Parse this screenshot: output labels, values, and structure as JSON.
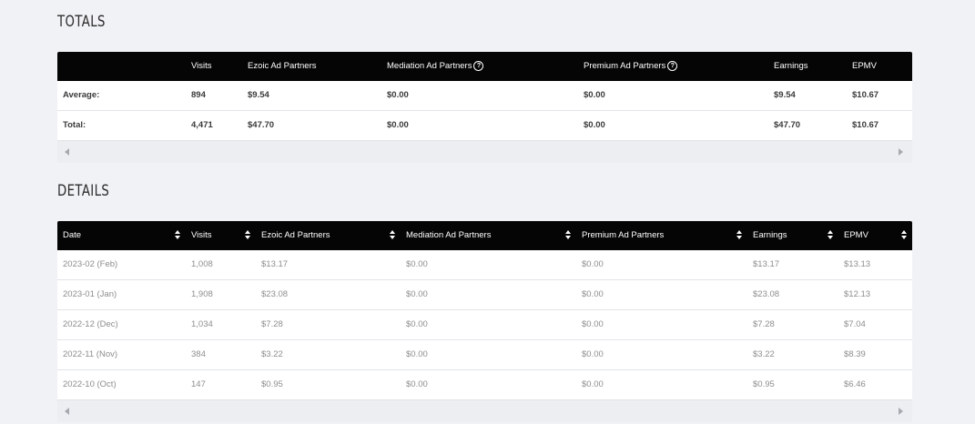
{
  "totals": {
    "title": "TOTALS",
    "columns": [
      "",
      "Visits",
      "Ezoic Ad Partners",
      "Mediation Ad Partners",
      "Premium Ad Partners",
      "Earnings",
      "EPMV"
    ],
    "info_columns": [
      "Mediation Ad Partners",
      "Premium Ad Partners"
    ],
    "rows": [
      [
        "Average:",
        "894",
        "$9.54",
        "$0.00",
        "$0.00",
        "$9.54",
        "$10.67"
      ],
      [
        "Total:",
        "4,471",
        "$47.70",
        "$0.00",
        "$0.00",
        "$47.70",
        "$10.67"
      ]
    ]
  },
  "details": {
    "title": "DETAILS",
    "columns": [
      "Date",
      "Visits",
      "Ezoic Ad Partners",
      "Mediation Ad Partners",
      "Premium Ad Partners",
      "Earnings",
      "EPMV"
    ],
    "rows": [
      [
        "2023-02 (Feb)",
        "1,008",
        "$13.17",
        "$0.00",
        "$0.00",
        "$13.17",
        "$13.13"
      ],
      [
        "2023-01 (Jan)",
        "1,908",
        "$23.08",
        "$0.00",
        "$0.00",
        "$23.08",
        "$12.13"
      ],
      [
        "2022-12 (Dec)",
        "1,034",
        "$7.28",
        "$0.00",
        "$0.00",
        "$7.28",
        "$7.04"
      ],
      [
        "2022-11 (Nov)",
        "384",
        "$3.22",
        "$0.00",
        "$0.00",
        "$3.22",
        "$8.39"
      ],
      [
        "2022-10 (Oct)",
        "147",
        "$0.95",
        "$0.00",
        "$0.00",
        "$0.95",
        "$6.46"
      ]
    ]
  },
  "icons": {
    "info": "question-circle-icon",
    "sort": "sort-icon",
    "scroll_left": "scroll-left-arrow-icon",
    "scroll_right": "scroll-right-arrow-icon"
  },
  "colors": {
    "header_bg": "#050505",
    "page_bg": "#f1f2f6",
    "row_bg": "#ffffff"
  }
}
